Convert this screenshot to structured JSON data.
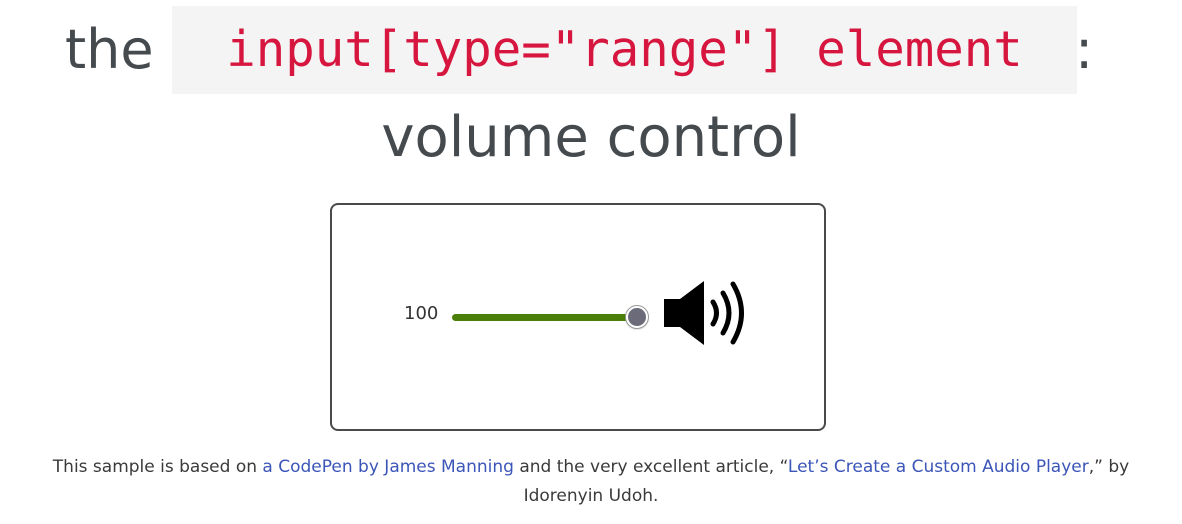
{
  "title": {
    "prefix": "the",
    "code": "input[type=\"range\"] element",
    "suffix": ":",
    "subtitle": "volume control"
  },
  "volume": {
    "value": "100",
    "level_fraction": 1.0,
    "track_color": "#4a7f0a",
    "thumb_color": "#6b6b7a",
    "icon": "speaker-volume-high-icon"
  },
  "footer": {
    "text_before": "This sample is based on ",
    "link1": "a CodePen by James Manning",
    "text_middle": " and the very excellent article, “",
    "link2": "Let’s Create a Custom Audio Player",
    "text_after": ",” by",
    "author": "Idorenyin Udoh."
  },
  "colors": {
    "code_text": "#d6163f",
    "code_bg": "#f4f4f4",
    "link": "#3b55b8"
  }
}
